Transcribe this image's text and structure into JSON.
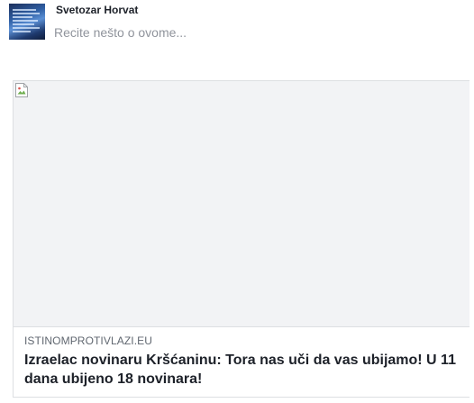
{
  "composer": {
    "author_name": "Svetozar Horvat",
    "placeholder": "Recite nešto o ovome..."
  },
  "link_preview": {
    "domain": "ISTINOMPROTIVLAZI.EU",
    "title": "Izraelac novinaru Kršćaninu: Tora nas uči da vas ubijamo! U 11 dana ubijeno 18 novinara!"
  },
  "icons": {
    "avatar": "profile-photo",
    "broken_image": "broken-image-icon"
  }
}
